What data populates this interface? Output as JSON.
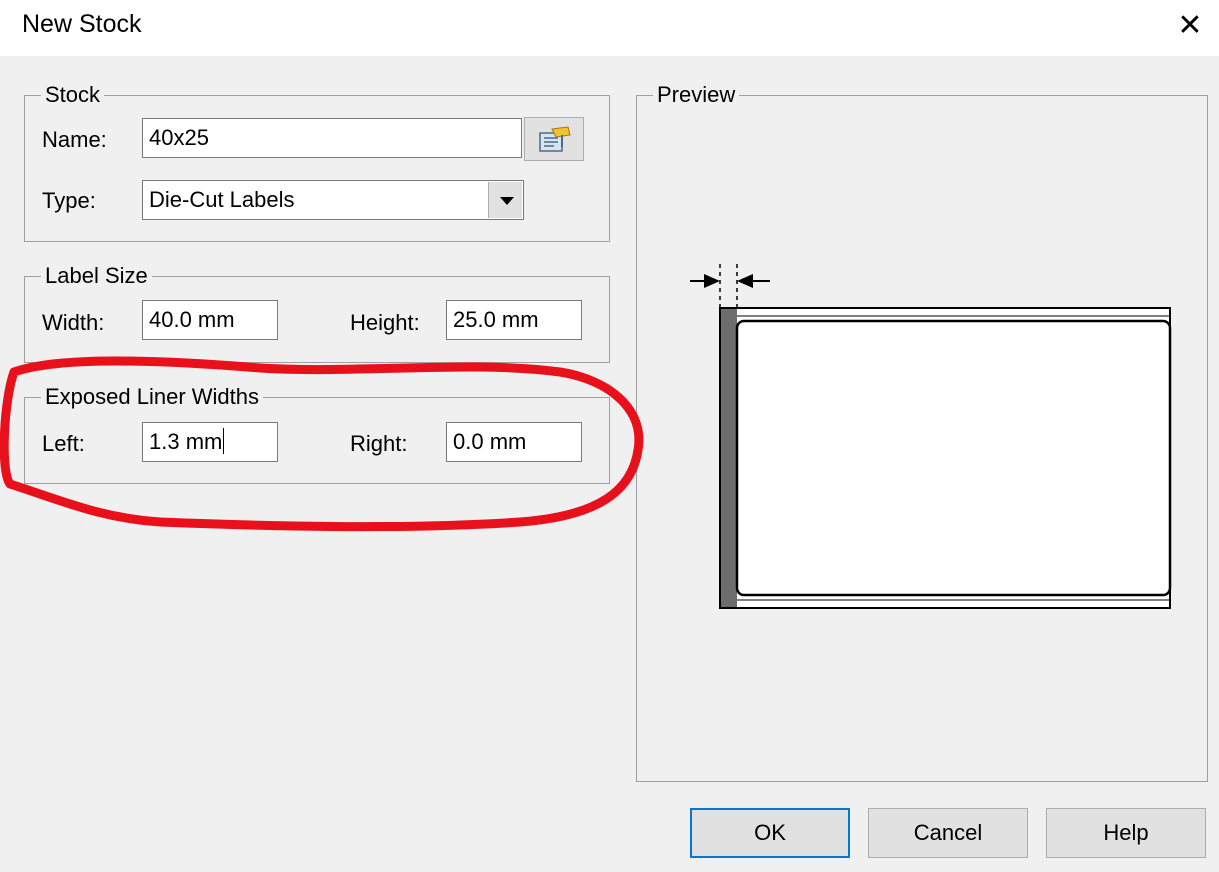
{
  "window": {
    "title": "New Stock",
    "close_symbol": "✕"
  },
  "stock": {
    "legend": "Stock",
    "name_label": "Name:",
    "name_value": "40x25",
    "type_label": "Type:",
    "type_value": "Die-Cut Labels",
    "browse_icon": "stock-library-icon"
  },
  "label_size": {
    "legend": "Label Size",
    "width_label": "Width:",
    "width_value": "40.0 mm",
    "height_label": "Height:",
    "height_value": "25.0 mm"
  },
  "liner": {
    "legend": "Exposed Liner Widths",
    "left_label": "Left:",
    "left_value": "1.3 mm",
    "right_label": "Right:",
    "right_value": "0.0 mm"
  },
  "preview": {
    "legend": "Preview"
  },
  "buttons": {
    "ok": "OK",
    "cancel": "Cancel",
    "help": "Help"
  },
  "colors": {
    "annotation": "#e8101a",
    "accent": "#0078d7",
    "liner": "#6d6d6d"
  }
}
